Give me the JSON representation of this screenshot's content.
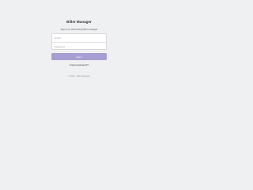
{
  "app": {
    "title": "Biller Manager",
    "subtitle": "Sign in to start using biller manager"
  },
  "form": {
    "email_placeholder": "Email",
    "password_placeholder": "Password",
    "login_label": "Log in",
    "forgot_label": "Forgot password?"
  },
  "footer": {
    "text": "© 2021 - Biller Manager"
  },
  "colors": {
    "background": "#eff0f2",
    "button": "#a79ed1"
  }
}
